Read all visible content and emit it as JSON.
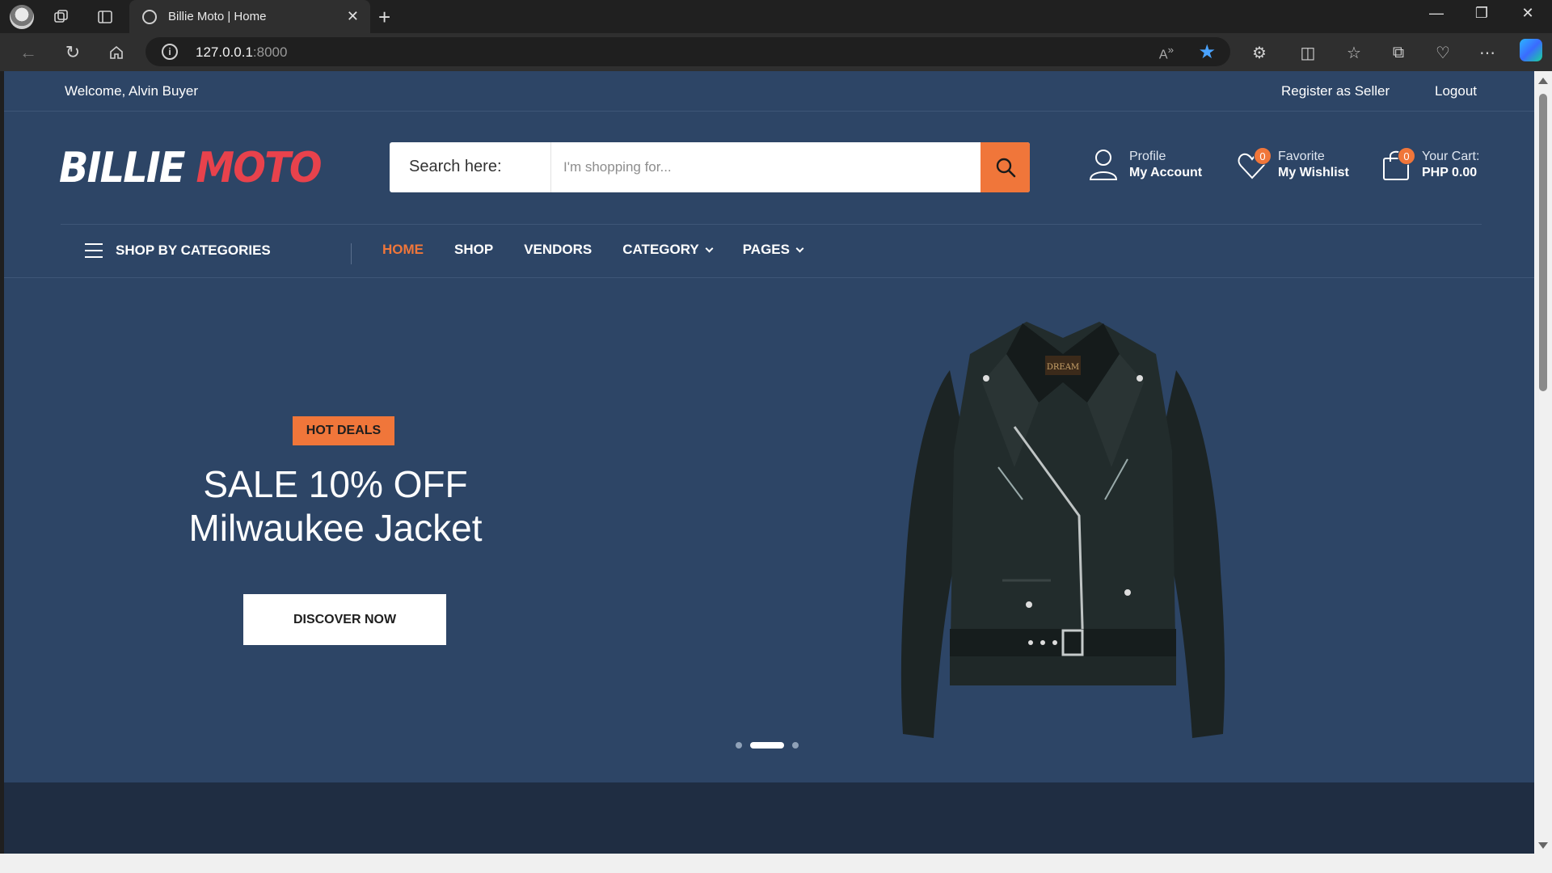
{
  "browser": {
    "tab_title": "Billie Moto | Home",
    "url_host": "127.0.0.1",
    "url_port": ":8000"
  },
  "topbar": {
    "welcome": "Welcome, Alvin Buyer",
    "register_seller": "Register as Seller",
    "logout": "Logout"
  },
  "logo": {
    "part1": "BILLIE",
    "part2": "MOTO"
  },
  "search": {
    "label": "Search here:",
    "placeholder": "I'm shopping for..."
  },
  "header": {
    "profile": {
      "line1": "Profile",
      "line2": "My Account"
    },
    "wishlist": {
      "line1": "Favorite",
      "line2": "My Wishlist",
      "count": "0"
    },
    "cart": {
      "line1": "Your Cart:",
      "line2": "PHP 0.00",
      "count": "0"
    }
  },
  "nav": {
    "categories": "SHOP BY CATEGORIES",
    "items": [
      "HOME",
      "SHOP",
      "VENDORS",
      "CATEGORY",
      "PAGES"
    ]
  },
  "hero": {
    "badge": "HOT DEALS",
    "title_line1": "SALE 10% OFF",
    "title_line2": "Milwaukee Jacket",
    "cta": "DISCOVER NOW",
    "slide_count": 3,
    "active_slide": 2
  },
  "colors": {
    "page_bg": "#2d4566",
    "accent": "#f0763a",
    "logo_red": "#e8424c"
  }
}
